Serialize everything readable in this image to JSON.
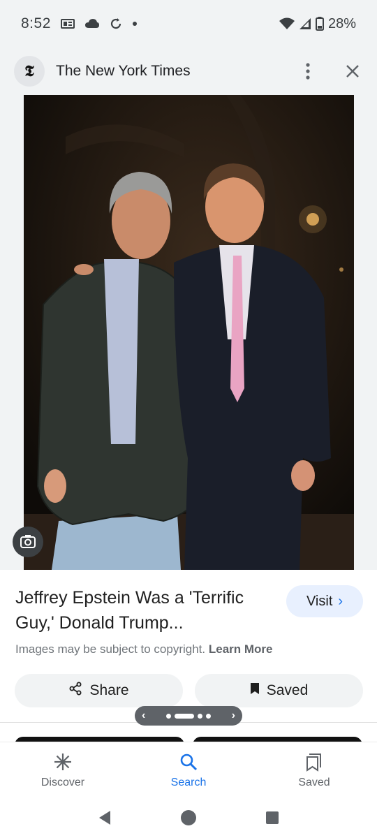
{
  "status_bar": {
    "time": "8:52",
    "battery": "28%",
    "icons": [
      "notification-icon",
      "cloud-icon",
      "sync-icon",
      "dot-icon",
      "wifi-icon",
      "signal-icon",
      "battery-icon"
    ]
  },
  "header": {
    "source_logo": "𝕿",
    "source_name": "The New York Times",
    "icons": [
      "more-vert-icon",
      "close-icon"
    ]
  },
  "image": {
    "description_icon": "google-lens-icon"
  },
  "result": {
    "title": "Jeffrey Epstein Was a 'Terrific Guy,' Donald Trump...",
    "visit_label": "Visit",
    "copyright_text": "Images may be subject to copyright.",
    "learn_more": "Learn More",
    "share_label": "Share",
    "saved_label": "Saved"
  },
  "pager": {
    "prev": "‹",
    "next": "›"
  },
  "bottom_nav": {
    "items": [
      {
        "label": "Discover",
        "icon": "asterisk-icon"
      },
      {
        "label": "Search",
        "icon": "search-icon"
      },
      {
        "label": "Saved",
        "icon": "collections-icon"
      }
    ],
    "active_color": "#1a73e8"
  },
  "system_nav": [
    "back-icon",
    "home-icon",
    "recents-icon"
  ]
}
